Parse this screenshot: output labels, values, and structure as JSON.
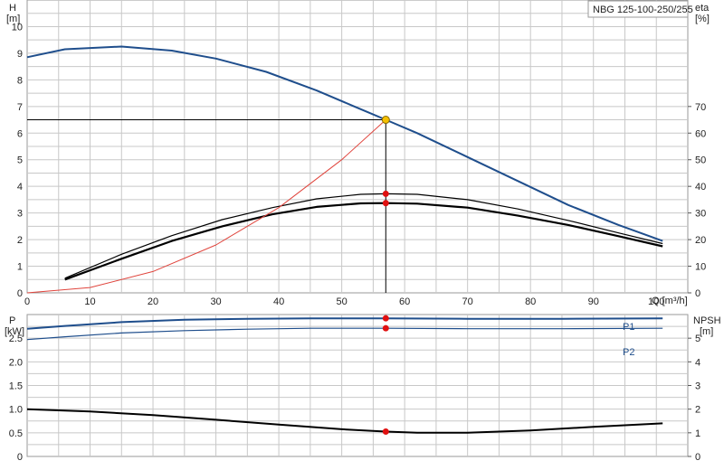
{
  "chart_data": [
    {
      "type": "line",
      "title": "NBG 125-100-250/255",
      "x_unit_label": "Q [m³/h]",
      "left_axis": {
        "name": "H",
        "unit": "[m]",
        "ylim": [
          0,
          11
        ],
        "ticks": [
          0,
          1,
          2,
          3,
          4,
          5,
          6,
          7,
          8,
          9,
          10
        ]
      },
      "right_axis": {
        "name": "eta",
        "unit": "[%]",
        "ylim": [
          0,
          110
        ],
        "ticks": [
          0,
          10,
          20,
          30,
          40,
          50,
          60,
          70
        ]
      },
      "x_axis": {
        "xlim": [
          0,
          105
        ],
        "ticks": [
          0,
          10,
          20,
          30,
          40,
          50,
          60,
          70,
          80,
          90,
          100
        ]
      },
      "series": [
        {
          "axis": "left",
          "color": "#1f4e8c",
          "width": 2,
          "x": [
            0,
            6,
            15,
            23,
            30,
            38,
            46,
            52,
            57,
            62,
            70,
            78,
            86,
            94,
            101
          ],
          "y": [
            8.85,
            9.15,
            9.25,
            9.1,
            8.8,
            8.3,
            7.6,
            7.0,
            6.5,
            6.0,
            5.1,
            4.2,
            3.3,
            2.55,
            1.95
          ]
        },
        {
          "axis": "right",
          "color": "#000000",
          "width": 1.2,
          "x": [
            6,
            15,
            23,
            31,
            39,
            46,
            53,
            57,
            62,
            70,
            78,
            86,
            94,
            101
          ],
          "y": [
            5.5,
            14.5,
            21.5,
            27.5,
            32,
            35.3,
            37,
            37.2,
            37,
            35,
            31.5,
            27.2,
            22.5,
            18.5
          ]
        },
        {
          "axis": "right",
          "color": "#000000",
          "width": 2.2,
          "x": [
            6,
            15,
            23,
            31,
            39,
            46,
            53,
            57,
            62,
            70,
            78,
            86,
            94,
            101
          ],
          "y": [
            5,
            12.8,
            19.5,
            25,
            29.5,
            32.3,
            33.6,
            33.7,
            33.5,
            32,
            29,
            25.5,
            21.3,
            17.5
          ]
        },
        {
          "axis": "left",
          "color": "#e0443c",
          "width": 1,
          "x": [
            0,
            10,
            20,
            30,
            40,
            50,
            57
          ],
          "y": [
            0,
            0.2,
            0.8,
            1.8,
            3.2,
            5.0,
            6.5
          ]
        }
      ],
      "markers": [
        {
          "x": 57,
          "y": 6.5,
          "axis": "left",
          "color": "#f5c000"
        },
        {
          "x": 57,
          "y": 37.2,
          "axis": "right",
          "color": "#e01010"
        },
        {
          "x": 57,
          "y": 33.7,
          "axis": "right",
          "color": "#e01010"
        }
      ],
      "duty_point": {
        "x": 57,
        "y": 6.5
      }
    },
    {
      "type": "line",
      "left_axis": {
        "name": "P",
        "unit": "[kW]",
        "ylim": [
          0,
          3
        ],
        "ticks": [
          0,
          0.5,
          1.0,
          1.5,
          2.0,
          2.5
        ],
        "tick_labels": [
          "0",
          "0.5",
          "1.0",
          "1.5",
          "2.0",
          "2.5"
        ]
      },
      "right_axis": {
        "name": "NPSH",
        "unit": "[m]",
        "ylim": [
          0,
          6
        ],
        "ticks": [
          0,
          1,
          2,
          3,
          4,
          5
        ]
      },
      "x_axis": {
        "xlim": [
          0,
          105
        ]
      },
      "series": [
        {
          "name": "P1",
          "axis": "left",
          "color": "#1f4e8c",
          "width": 2,
          "x": [
            0,
            6,
            15,
            25,
            35,
            45,
            57,
            70,
            85,
            101
          ],
          "y": [
            2.7,
            2.76,
            2.84,
            2.89,
            2.91,
            2.92,
            2.92,
            2.91,
            2.91,
            2.92
          ]
        },
        {
          "name": "P2",
          "axis": "left",
          "color": "#1f4e8c",
          "width": 1.2,
          "x": [
            0,
            6,
            15,
            25,
            35,
            45,
            57,
            70,
            85,
            101
          ],
          "y": [
            2.47,
            2.53,
            2.61,
            2.66,
            2.69,
            2.71,
            2.71,
            2.7,
            2.7,
            2.71
          ]
        },
        {
          "axis": "right",
          "color": "#000000",
          "width": 2,
          "x": [
            0,
            10,
            20,
            30,
            40,
            50,
            57,
            62,
            70,
            80,
            90,
            101
          ],
          "y": [
            2.0,
            1.9,
            1.75,
            1.55,
            1.35,
            1.15,
            1.05,
            1.0,
            1.0,
            1.1,
            1.25,
            1.4
          ]
        }
      ],
      "markers": [
        {
          "x": 57,
          "y": 2.92,
          "axis": "left",
          "color": "#e01010"
        },
        {
          "x": 57,
          "y": 2.71,
          "axis": "left",
          "color": "#e01010"
        },
        {
          "x": 57,
          "y": 1.05,
          "axis": "right",
          "color": "#e01010"
        }
      ]
    }
  ]
}
